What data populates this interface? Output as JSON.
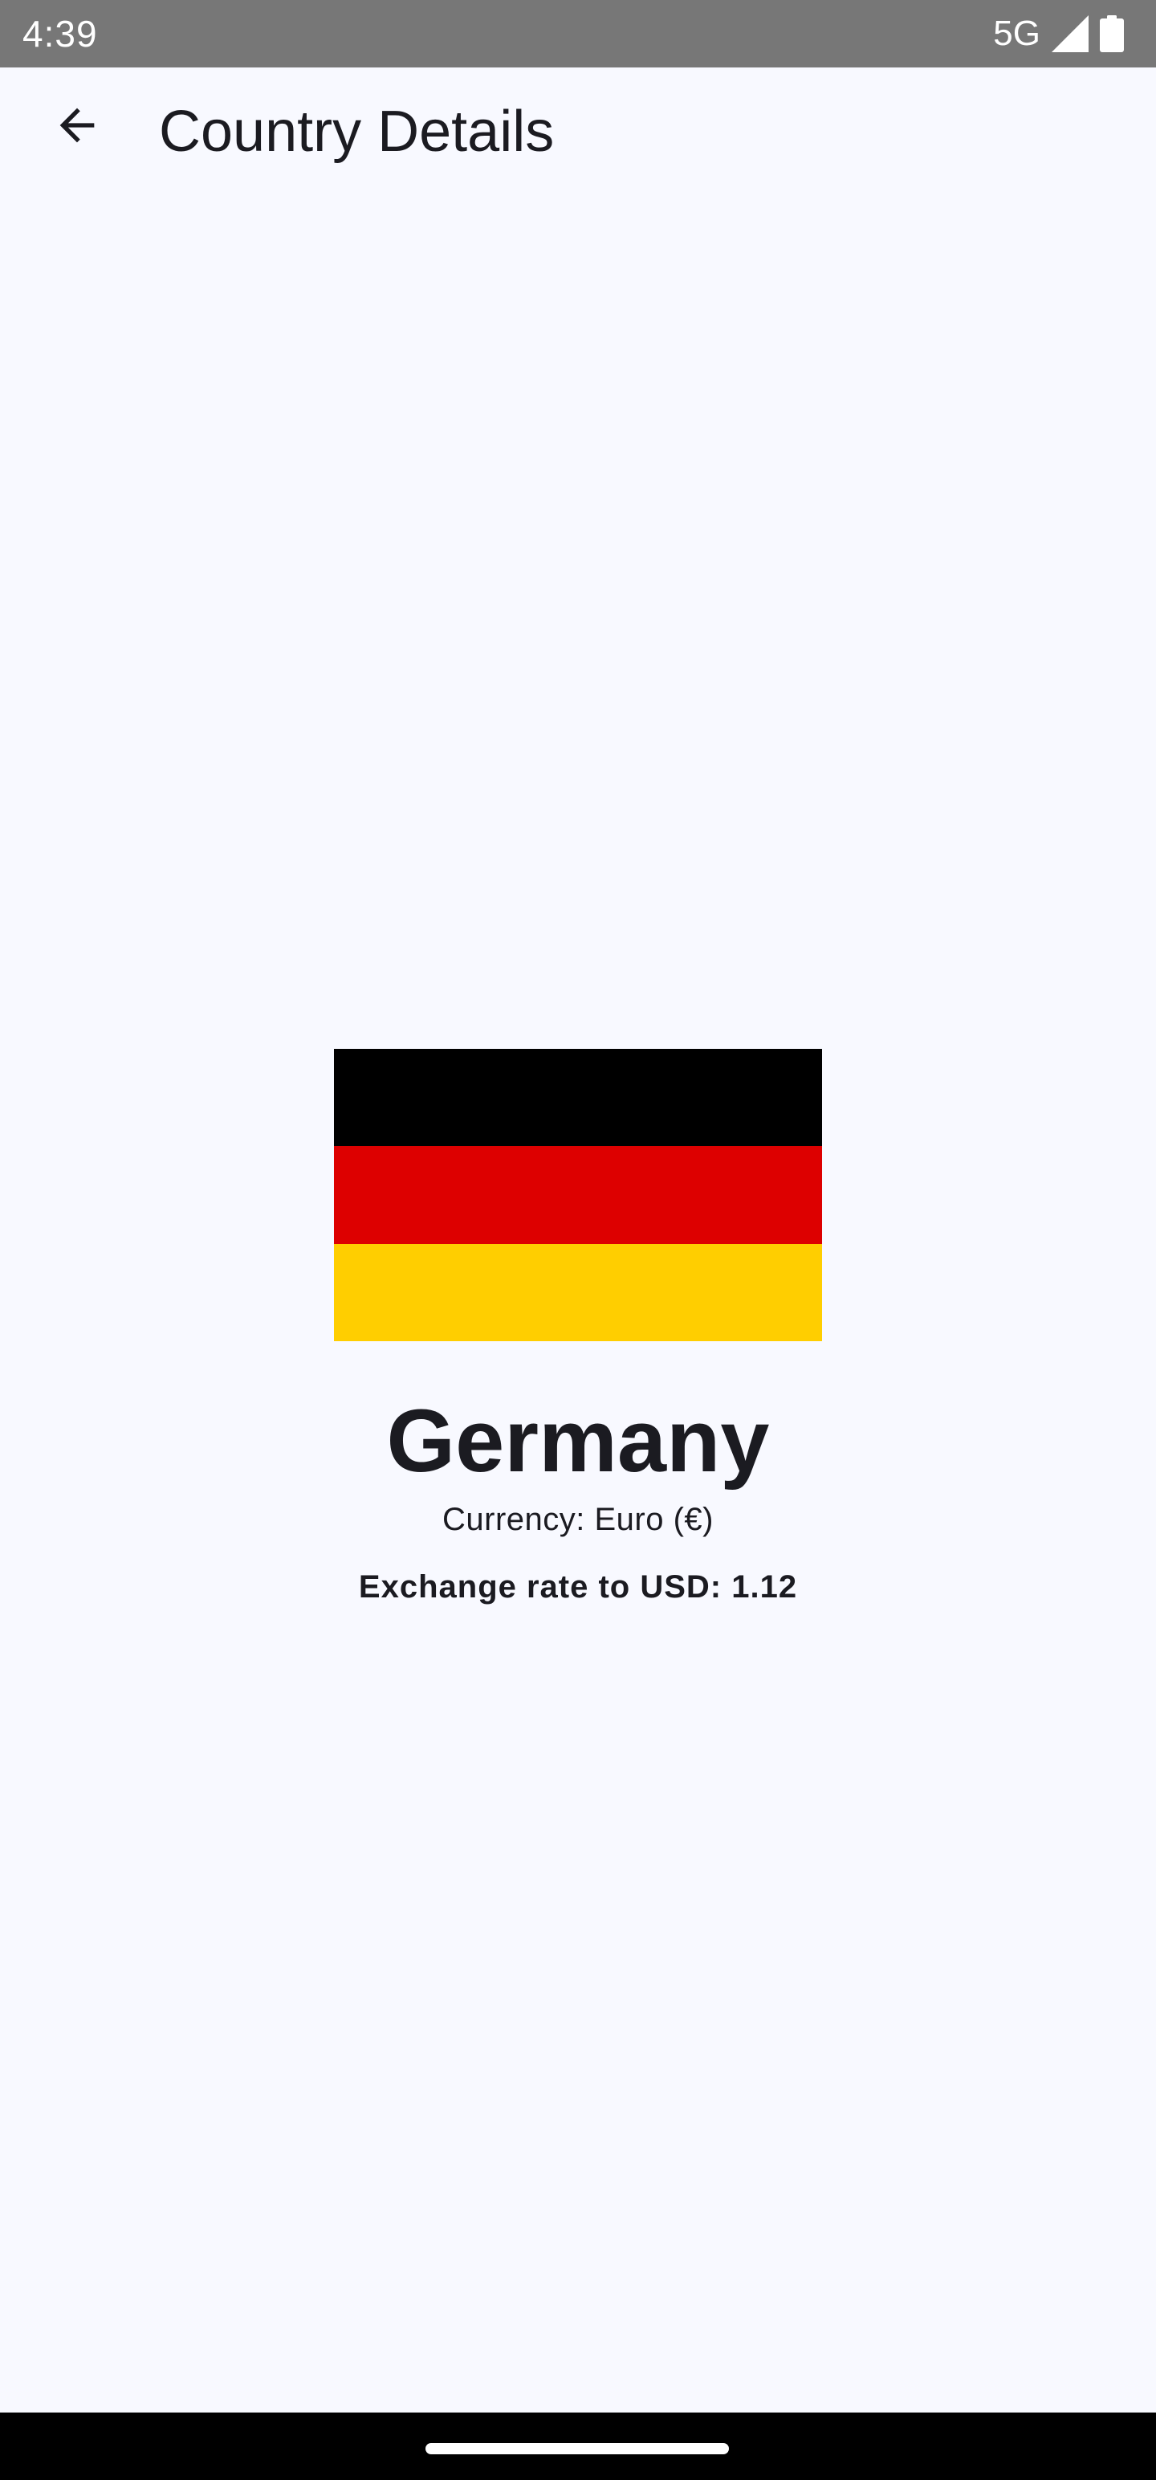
{
  "status_bar": {
    "time": "4:39",
    "network": "5G",
    "signal_icon": "signal-full-icon",
    "battery_icon": "battery-full-icon",
    "background": "#777777"
  },
  "app_bar": {
    "title": "Country Details",
    "back_icon": "arrow-back-icon"
  },
  "country": {
    "name": "Germany",
    "currency": "Currency: Euro (€)",
    "exchange_rate": "Exchange rate to USD: 1.12",
    "flag_colors": [
      "#000000",
      "#dd0000",
      "#ffce00"
    ]
  },
  "colors": {
    "background": "#f8f9ff",
    "text": "#1b1b21"
  }
}
